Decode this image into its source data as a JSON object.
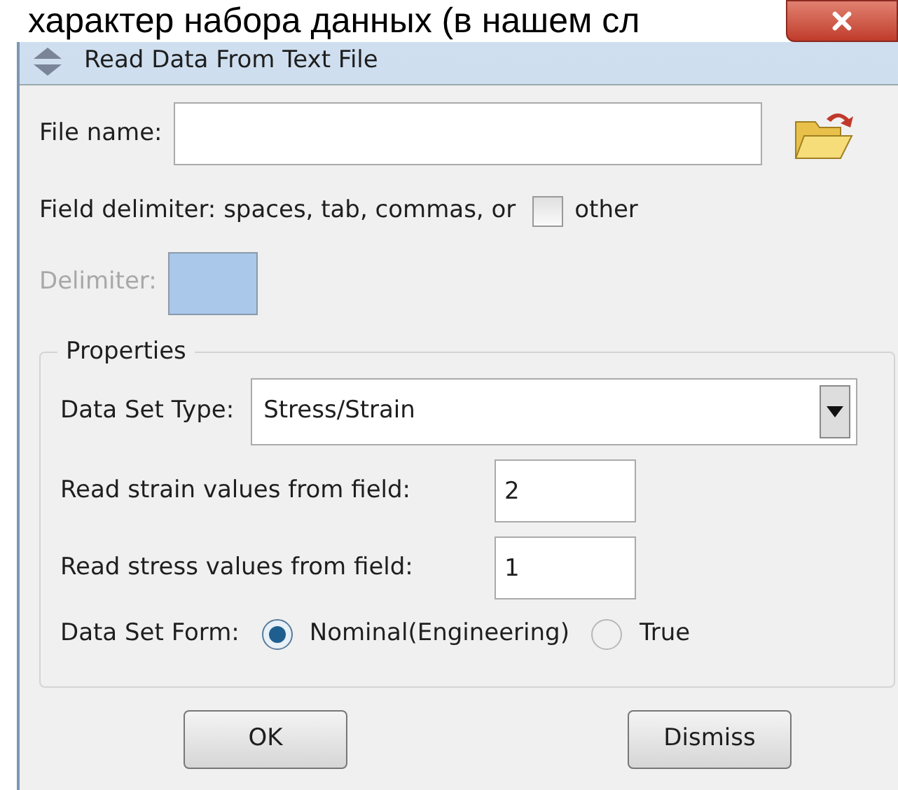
{
  "background_text": "характер набора данных (в нашем сл",
  "window": {
    "title": "Read Data From Text File"
  },
  "file_name": {
    "label": "File name:"
  },
  "field_delimiter": {
    "label": "Field delimiter: spaces, tab, commas, or",
    "other_label": "other",
    "checked": false
  },
  "delimiter": {
    "label": "Delimiter:",
    "disabled": true
  },
  "properties": {
    "title": "Properties",
    "data_set_type": {
      "label": "Data Set Type:",
      "value": "Stress/Strain"
    },
    "strain_field": {
      "label": "Read strain values from field:",
      "value": "2"
    },
    "stress_field": {
      "label": "Read stress values from field:",
      "value": "1"
    },
    "data_set_form": {
      "label": "Data Set Form:",
      "options": [
        {
          "label": "Nominal(Engineering)",
          "selected": true
        },
        {
          "label": "True",
          "selected": false
        }
      ]
    }
  },
  "buttons": [
    "OK",
    "Dismiss"
  ]
}
